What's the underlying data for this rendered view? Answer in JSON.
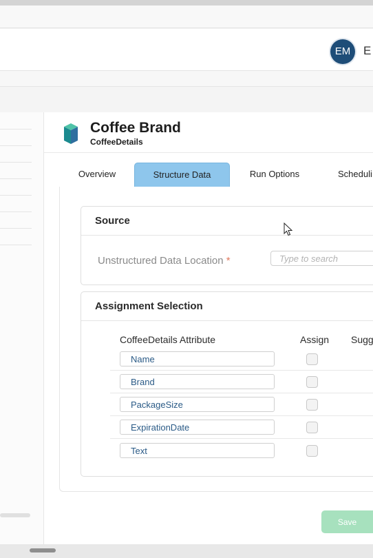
{
  "header": {
    "user_initials": "EM",
    "user_name_fragment": "E"
  },
  "page": {
    "title": "Coffee Brand",
    "subtitle": "CoffeeDetails",
    "icon": "entity-cube-icon"
  },
  "tabs": [
    {
      "label": "Overview",
      "active": false
    },
    {
      "label": "Structure Data",
      "active": true
    },
    {
      "label": "Run Options",
      "active": false
    },
    {
      "label": "Scheduli",
      "active": false
    }
  ],
  "source": {
    "title": "Source",
    "field_label": "Unstructured Data Location",
    "required_mark": "*",
    "placeholder": "Type to search",
    "value": ""
  },
  "assignment": {
    "title": "Assignment Selection",
    "columns": [
      "CoffeeDetails Attribute",
      "Assign",
      "Sugg"
    ],
    "rows": [
      {
        "attribute": "Name",
        "assigned": false
      },
      {
        "attribute": "Brand",
        "assigned": false
      },
      {
        "attribute": "PackageSize",
        "assigned": false
      },
      {
        "attribute": "ExpirationDate",
        "assigned": false
      },
      {
        "attribute": "Text",
        "assigned": false
      }
    ]
  },
  "actions": {
    "save_label": "Save"
  },
  "colors": {
    "active_tab": "#8ec6ec",
    "avatar": "#1e4d78",
    "save_button": "#a7e1be",
    "required": "#e07a5f"
  }
}
